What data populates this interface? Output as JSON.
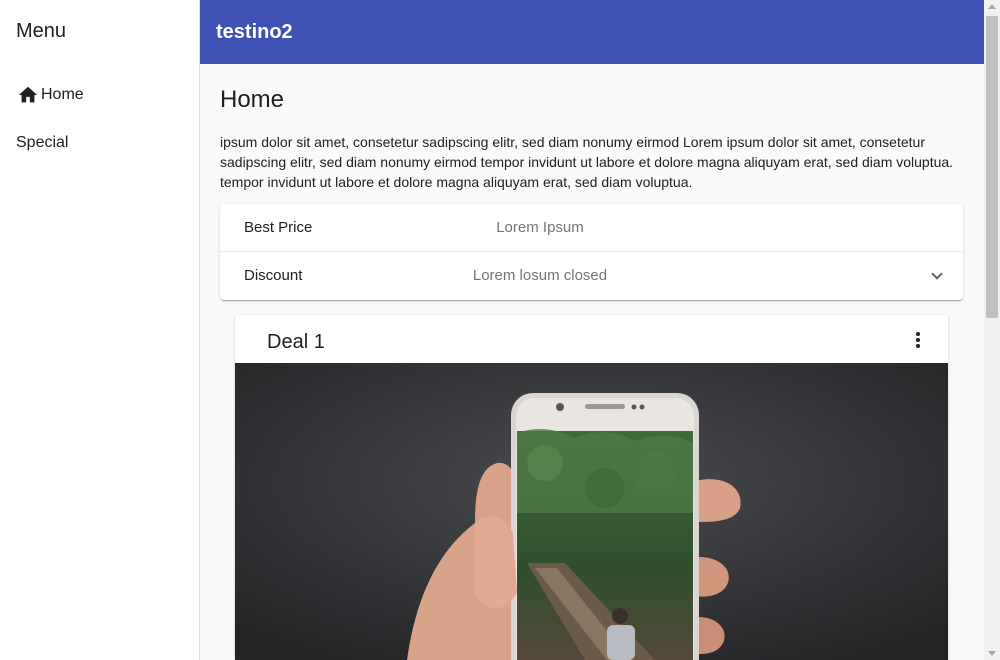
{
  "sidebar": {
    "title": "Menu",
    "items": [
      {
        "label": "Home",
        "icon": "home-icon"
      },
      {
        "label": "Special"
      }
    ]
  },
  "toolbar": {
    "title": "testino2",
    "color": "#3f51b5"
  },
  "main": {
    "page_title": "Home",
    "intro": "ipsum dolor sit amet, consetetur sadipscing elitr, sed diam nonumy eirmod Lorem ipsum dolor sit amet, consetetur sadipscing elitr, sed diam nonumy eirmod tempor invidunt ut labore et dolore magna aliquyam erat, sed diam voluptua. tempor invidunt ut labore et dolore magna aliquyam erat, sed diam voluptua.",
    "panel": {
      "rows": [
        {
          "label": "Best Price",
          "value": "Lorem Ipsum"
        },
        {
          "label": "Discount",
          "value": "Lorem losum closed"
        }
      ]
    },
    "card": {
      "title": "Deal 1",
      "menu_icon": "more-vert-icon",
      "image": "hand-holding-phone-railway-photo"
    }
  }
}
